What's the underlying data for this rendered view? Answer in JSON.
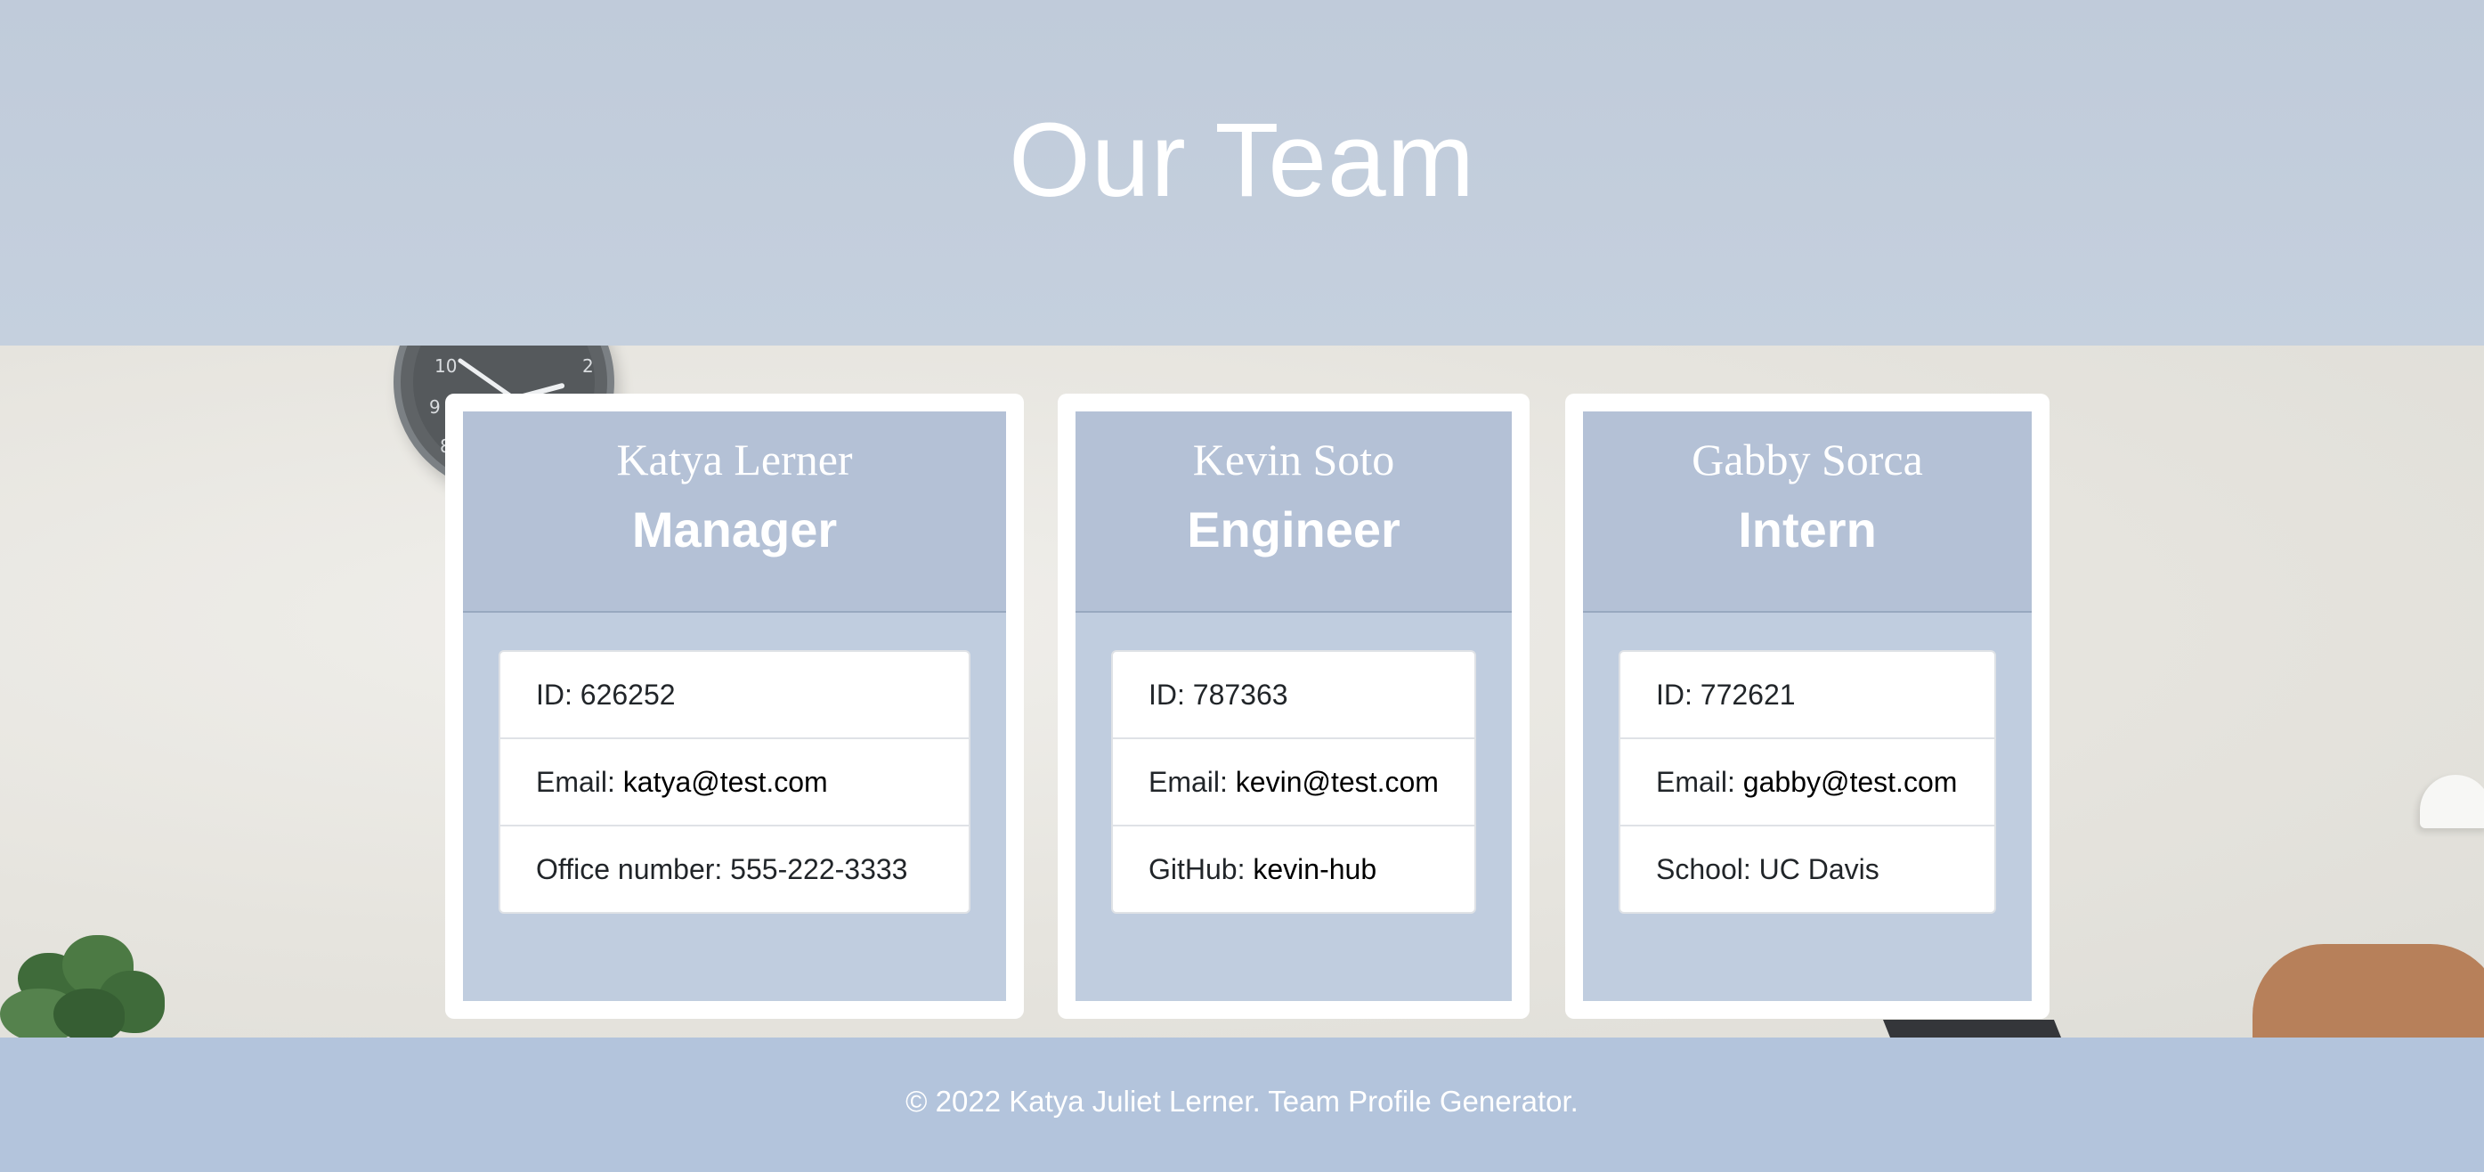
{
  "header": {
    "title": "Our Team"
  },
  "team": [
    {
      "name": "Katya Lerner",
      "role": "Manager",
      "id_label": "ID: ",
      "id": "626252",
      "email_label": "Email: ",
      "email": "katya@test.com",
      "extra_label": "Office number: ",
      "extra": "555-222-3333"
    },
    {
      "name": "Kevin Soto",
      "role": "Engineer",
      "id_label": "ID: ",
      "id": "787363",
      "email_label": "Email: ",
      "email": "kevin@test.com",
      "extra_label": "GitHub: ",
      "extra": "kevin-hub"
    },
    {
      "name": "Gabby Sorca",
      "role": "Intern",
      "id_label": "ID: ",
      "id": "772621",
      "email_label": "Email: ",
      "email": "gabby@test.com",
      "extra_label": "School: ",
      "extra": "UC Davis"
    }
  ],
  "footer": {
    "text": "© 2022 Katya Juliet Lerner. Team Profile Generator."
  },
  "colors": {
    "header_bg": "#c2cddc",
    "footer_bg": "#b3c4dc",
    "card_accent": "#b2c2d8"
  },
  "background_icons": [
    "wall-clock-icon",
    "plant-icon",
    "lamp-icon",
    "chair-icon",
    "laptop-icon"
  ]
}
